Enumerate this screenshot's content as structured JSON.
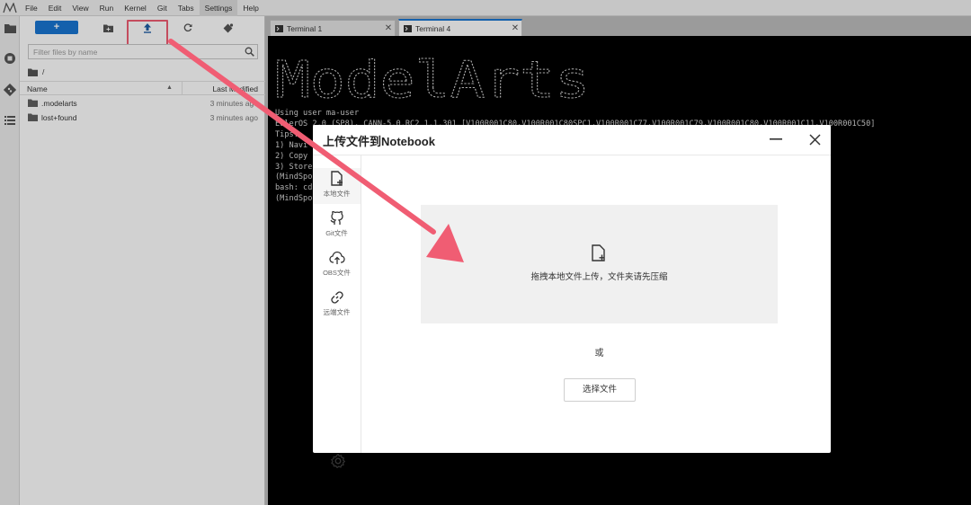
{
  "menu": {
    "items": [
      "File",
      "Edit",
      "View",
      "Run",
      "Kernel",
      "Git",
      "Tabs",
      "Settings",
      "Help"
    ],
    "active": "Settings"
  },
  "file_browser": {
    "new_button_label": "+",
    "filter_placeholder": "Filter files by name",
    "breadcrumb": "/",
    "columns": {
      "name": "Name",
      "last_modified": "Last Modified"
    },
    "files": [
      {
        "name": ".modelarts",
        "modified": "3 minutes ago",
        "type": "folder"
      },
      {
        "name": "lost+found",
        "modified": "3 minutes ago",
        "type": "folder"
      }
    ]
  },
  "tabs": [
    {
      "label": "Terminal 1",
      "active": false
    },
    {
      "label": "Terminal 4",
      "active": true
    }
  ],
  "terminal": {
    "banner": "ModelArts",
    "lines": [
      "Using user ma-user",
      "EulerOS 2.0 (SP8), CANN-5.0.RC2 1.1.301 [V100R001C80,V100R001C80SPC1,V100R001C77,V100R001C79,V100R001C80,V100R001C11,V100R001C50]",
      "Tips:",
      "1) Navi",
      "2) Copy",
      "3) Store",
      "(MindSpo",
      "bash: cd",
      "(MindSpo"
    ]
  },
  "upload_dialog": {
    "title": "上传文件到Notebook",
    "nav": [
      {
        "label": "本地文件",
        "icon": "file-add-icon",
        "active": true
      },
      {
        "label": "Git文件",
        "icon": "github-icon",
        "active": false
      },
      {
        "label": "OBS文件",
        "icon": "cloud-upload-icon",
        "active": false
      },
      {
        "label": "远端文件",
        "icon": "link-icon",
        "active": false
      }
    ],
    "drop_text": "拖拽本地文件上传，文件夹请先压缩",
    "or_text": "或",
    "choose_button": "选择文件"
  },
  "colors": {
    "accent": "#1976d2",
    "highlight": "#f05d73",
    "terminal_bg": "#000000"
  }
}
